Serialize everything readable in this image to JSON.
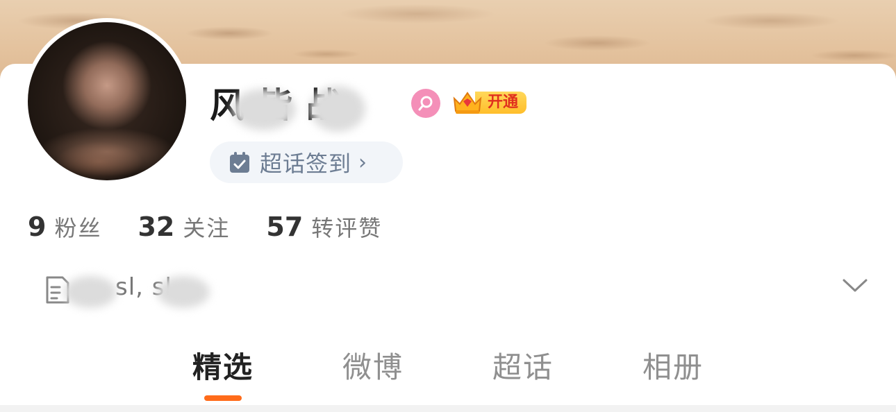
{
  "profile": {
    "name": "风 皆 战",
    "gender_icon": "female-icon",
    "vip_label": "开通",
    "checkin_label": "超话签到",
    "checkin_chevron": "›"
  },
  "stats": [
    {
      "value": "9",
      "label": "粉丝"
    },
    {
      "value": "32",
      "label": "关注"
    },
    {
      "value": "57",
      "label": "转评赞"
    }
  ],
  "bio": {
    "text": "sl,   sl"
  },
  "tabs": [
    {
      "label": "精选",
      "active": true
    },
    {
      "label": "微博",
      "active": false
    },
    {
      "label": "超话",
      "active": false
    },
    {
      "label": "相册",
      "active": false
    }
  ],
  "colors": {
    "accent": "#ff6b1a",
    "gender_badge": "#f48fb8",
    "checkin_text": "#6d7d93"
  }
}
